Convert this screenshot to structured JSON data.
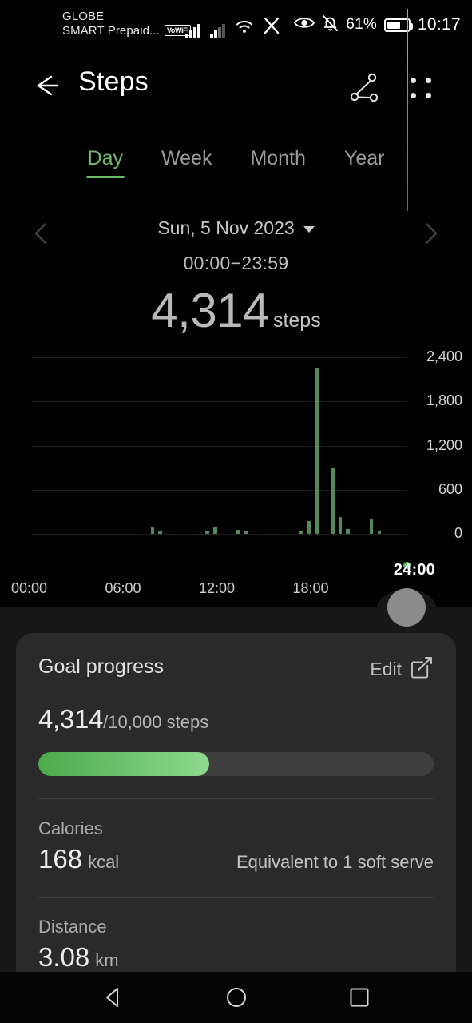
{
  "status_bar": {
    "carrier_primary": "GLOBE",
    "carrier_secondary": "SMART Prepaid...",
    "vowifi_badge": "VoWiFi",
    "battery_percent": "61%",
    "clock": "10:17"
  },
  "app_bar": {
    "title": "Steps",
    "back_icon": "arrow-left-icon",
    "share_icon": "share-nodes-icon",
    "menu_icon": "grid-dots-menu-icon"
  },
  "tabs": [
    {
      "label": "Day",
      "active": true
    },
    {
      "label": "Week",
      "active": false
    },
    {
      "label": "Month",
      "active": false
    },
    {
      "label": "Year",
      "active": false
    }
  ],
  "date_nav": {
    "prev_icon": "chevron-left-icon",
    "next_icon": "chevron-right-icon",
    "date": "Sun, 5 Nov 2023",
    "dropdown_icon": "caret-down-icon",
    "time_range": "00:00−23:59",
    "total_value": "4,314",
    "total_unit": "steps"
  },
  "chart_data": {
    "type": "bar",
    "title": "Steps per hour",
    "xlabel": "",
    "ylabel": "",
    "ylim": [
      0,
      2400
    ],
    "yticks": [
      "0",
      "600",
      "1,200",
      "1,800",
      "2,400"
    ],
    "xticks": [
      "00:00",
      "06:00",
      "12:00",
      "18:00"
    ],
    "grid": true,
    "accent_color": "#568a56",
    "cursor": {
      "label": "24:00",
      "color": "#4ec94e",
      "position_hours": 24
    },
    "categories": [
      "00:00",
      "00:30",
      "01:00",
      "01:30",
      "02:00",
      "02:30",
      "03:00",
      "03:30",
      "04:00",
      "04:30",
      "05:00",
      "05:30",
      "06:00",
      "06:30",
      "07:00",
      "07:30",
      "08:00",
      "08:30",
      "09:00",
      "09:30",
      "10:00",
      "10:30",
      "11:00",
      "11:30",
      "12:00",
      "12:30",
      "13:00",
      "13:30",
      "14:00",
      "14:30",
      "15:00",
      "15:30",
      "16:00",
      "16:30",
      "17:00",
      "17:30",
      "18:00",
      "18:30",
      "19:00",
      "19:30",
      "20:00",
      "20:30",
      "21:00",
      "21:30",
      "22:00",
      "22:30",
      "23:00",
      "23:30"
    ],
    "values": [
      0,
      0,
      0,
      0,
      0,
      0,
      0,
      0,
      0,
      0,
      0,
      0,
      0,
      0,
      0,
      95,
      30,
      0,
      0,
      0,
      0,
      0,
      45,
      100,
      0,
      0,
      50,
      20,
      0,
      0,
      0,
      0,
      0,
      0,
      20,
      170,
      2250,
      0,
      900,
      230,
      60,
      0,
      0,
      200,
      30,
      0,
      0,
      0
    ]
  },
  "goal_card": {
    "title": "Goal progress",
    "edit_label": "Edit",
    "edit_icon": "edit-square-icon",
    "current": "4,314",
    "target": "/10,000 steps",
    "progress_percent": 43.14,
    "calories": {
      "label": "Calories",
      "value": "168",
      "unit": "kcal",
      "note": "Equivalent to 1 soft serve"
    },
    "distance": {
      "label": "Distance",
      "value": "3.08",
      "unit": "km"
    }
  },
  "nav_bar": {
    "back_icon": "nav-back-triangle-icon",
    "home_icon": "nav-home-circle-icon",
    "recents_icon": "nav-recents-square-icon"
  }
}
